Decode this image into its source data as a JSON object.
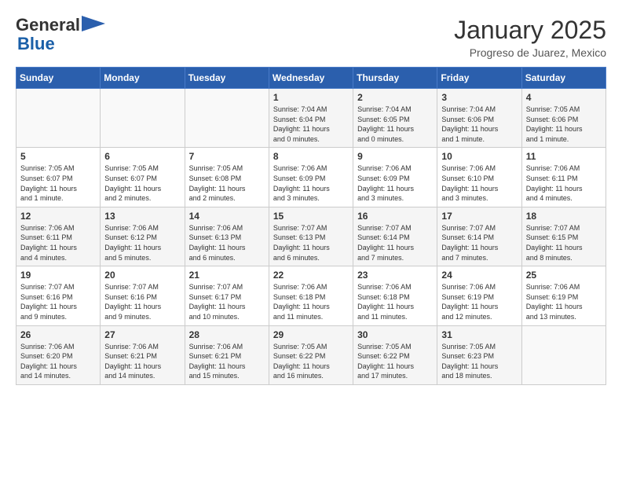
{
  "header": {
    "logo_line1": "General",
    "logo_line2": "Blue",
    "title": "January 2025",
    "subtitle": "Progreso de Juarez, Mexico"
  },
  "calendar": {
    "headers": [
      "Sunday",
      "Monday",
      "Tuesday",
      "Wednesday",
      "Thursday",
      "Friday",
      "Saturday"
    ],
    "weeks": [
      [
        {
          "day": "",
          "info": ""
        },
        {
          "day": "",
          "info": ""
        },
        {
          "day": "",
          "info": ""
        },
        {
          "day": "1",
          "info": "Sunrise: 7:04 AM\nSunset: 6:04 PM\nDaylight: 11 hours\nand 0 minutes."
        },
        {
          "day": "2",
          "info": "Sunrise: 7:04 AM\nSunset: 6:05 PM\nDaylight: 11 hours\nand 0 minutes."
        },
        {
          "day": "3",
          "info": "Sunrise: 7:04 AM\nSunset: 6:06 PM\nDaylight: 11 hours\nand 1 minute."
        },
        {
          "day": "4",
          "info": "Sunrise: 7:05 AM\nSunset: 6:06 PM\nDaylight: 11 hours\nand 1 minute."
        }
      ],
      [
        {
          "day": "5",
          "info": "Sunrise: 7:05 AM\nSunset: 6:07 PM\nDaylight: 11 hours\nand 1 minute."
        },
        {
          "day": "6",
          "info": "Sunrise: 7:05 AM\nSunset: 6:07 PM\nDaylight: 11 hours\nand 2 minutes."
        },
        {
          "day": "7",
          "info": "Sunrise: 7:05 AM\nSunset: 6:08 PM\nDaylight: 11 hours\nand 2 minutes."
        },
        {
          "day": "8",
          "info": "Sunrise: 7:06 AM\nSunset: 6:09 PM\nDaylight: 11 hours\nand 3 minutes."
        },
        {
          "day": "9",
          "info": "Sunrise: 7:06 AM\nSunset: 6:09 PM\nDaylight: 11 hours\nand 3 minutes."
        },
        {
          "day": "10",
          "info": "Sunrise: 7:06 AM\nSunset: 6:10 PM\nDaylight: 11 hours\nand 3 minutes."
        },
        {
          "day": "11",
          "info": "Sunrise: 7:06 AM\nSunset: 6:11 PM\nDaylight: 11 hours\nand 4 minutes."
        }
      ],
      [
        {
          "day": "12",
          "info": "Sunrise: 7:06 AM\nSunset: 6:11 PM\nDaylight: 11 hours\nand 4 minutes."
        },
        {
          "day": "13",
          "info": "Sunrise: 7:06 AM\nSunset: 6:12 PM\nDaylight: 11 hours\nand 5 minutes."
        },
        {
          "day": "14",
          "info": "Sunrise: 7:06 AM\nSunset: 6:13 PM\nDaylight: 11 hours\nand 6 minutes."
        },
        {
          "day": "15",
          "info": "Sunrise: 7:07 AM\nSunset: 6:13 PM\nDaylight: 11 hours\nand 6 minutes."
        },
        {
          "day": "16",
          "info": "Sunrise: 7:07 AM\nSunset: 6:14 PM\nDaylight: 11 hours\nand 7 minutes."
        },
        {
          "day": "17",
          "info": "Sunrise: 7:07 AM\nSunset: 6:14 PM\nDaylight: 11 hours\nand 7 minutes."
        },
        {
          "day": "18",
          "info": "Sunrise: 7:07 AM\nSunset: 6:15 PM\nDaylight: 11 hours\nand 8 minutes."
        }
      ],
      [
        {
          "day": "19",
          "info": "Sunrise: 7:07 AM\nSunset: 6:16 PM\nDaylight: 11 hours\nand 9 minutes."
        },
        {
          "day": "20",
          "info": "Sunrise: 7:07 AM\nSunset: 6:16 PM\nDaylight: 11 hours\nand 9 minutes."
        },
        {
          "day": "21",
          "info": "Sunrise: 7:07 AM\nSunset: 6:17 PM\nDaylight: 11 hours\nand 10 minutes."
        },
        {
          "day": "22",
          "info": "Sunrise: 7:06 AM\nSunset: 6:18 PM\nDaylight: 11 hours\nand 11 minutes."
        },
        {
          "day": "23",
          "info": "Sunrise: 7:06 AM\nSunset: 6:18 PM\nDaylight: 11 hours\nand 11 minutes."
        },
        {
          "day": "24",
          "info": "Sunrise: 7:06 AM\nSunset: 6:19 PM\nDaylight: 11 hours\nand 12 minutes."
        },
        {
          "day": "25",
          "info": "Sunrise: 7:06 AM\nSunset: 6:19 PM\nDaylight: 11 hours\nand 13 minutes."
        }
      ],
      [
        {
          "day": "26",
          "info": "Sunrise: 7:06 AM\nSunset: 6:20 PM\nDaylight: 11 hours\nand 14 minutes."
        },
        {
          "day": "27",
          "info": "Sunrise: 7:06 AM\nSunset: 6:21 PM\nDaylight: 11 hours\nand 14 minutes."
        },
        {
          "day": "28",
          "info": "Sunrise: 7:06 AM\nSunset: 6:21 PM\nDaylight: 11 hours\nand 15 minutes."
        },
        {
          "day": "29",
          "info": "Sunrise: 7:05 AM\nSunset: 6:22 PM\nDaylight: 11 hours\nand 16 minutes."
        },
        {
          "day": "30",
          "info": "Sunrise: 7:05 AM\nSunset: 6:22 PM\nDaylight: 11 hours\nand 17 minutes."
        },
        {
          "day": "31",
          "info": "Sunrise: 7:05 AM\nSunset: 6:23 PM\nDaylight: 11 hours\nand 18 minutes."
        },
        {
          "day": "",
          "info": ""
        }
      ]
    ]
  }
}
